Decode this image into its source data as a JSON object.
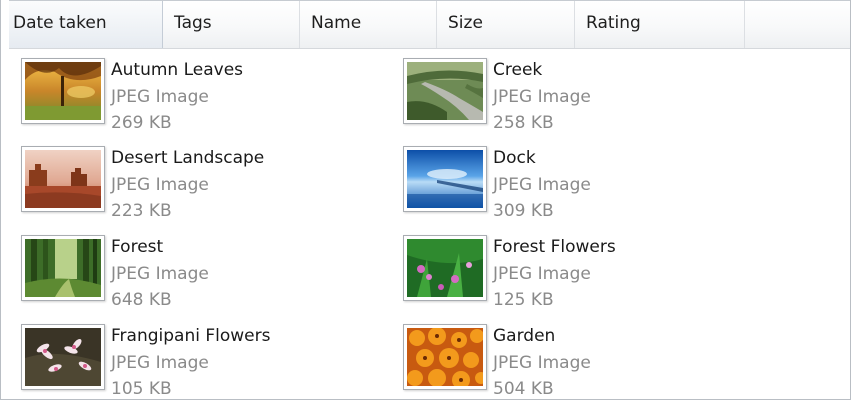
{
  "columns": [
    {
      "label": "Date taken"
    },
    {
      "label": "Tags"
    },
    {
      "label": "Name"
    },
    {
      "label": "Size"
    },
    {
      "label": "Rating"
    }
  ],
  "files": [
    {
      "name": "Autumn Leaves",
      "type": "JPEG Image",
      "size": "269 KB",
      "thumb": "autumn-leaves-thumbnail"
    },
    {
      "name": "Creek",
      "type": "JPEG Image",
      "size": "258 KB",
      "thumb": "creek-thumbnail"
    },
    {
      "name": "Desert Landscape",
      "type": "JPEG Image",
      "size": "223 KB",
      "thumb": "desert-landscape-thumbnail"
    },
    {
      "name": "Dock",
      "type": "JPEG Image",
      "size": "309 KB",
      "thumb": "dock-thumbnail"
    },
    {
      "name": "Forest",
      "type": "JPEG Image",
      "size": "648 KB",
      "thumb": "forest-thumbnail"
    },
    {
      "name": "Forest Flowers",
      "type": "JPEG Image",
      "size": "125 KB",
      "thumb": "forest-flowers-thumbnail"
    },
    {
      "name": "Frangipani Flowers",
      "type": "JPEG Image",
      "size": "105 KB",
      "thumb": "frangipani-flowers-thumbnail"
    },
    {
      "name": "Garden",
      "type": "JPEG Image",
      "size": "504 KB",
      "thumb": "garden-thumbnail"
    }
  ]
}
